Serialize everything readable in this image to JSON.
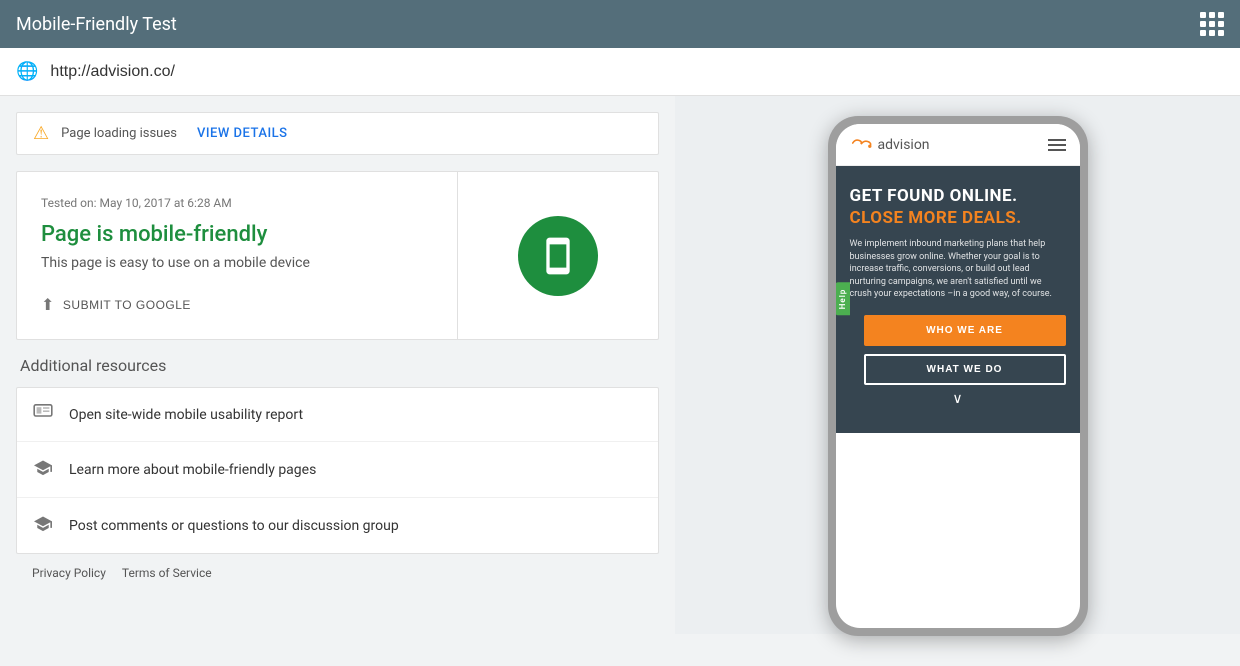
{
  "app": {
    "title": "Mobile-Friendly Test",
    "grid_icon_label": "apps"
  },
  "urlbar": {
    "url": "http://advision.co/"
  },
  "warning": {
    "text": "Page loading issues",
    "link": "VIEW DETAILS"
  },
  "result": {
    "tested_on": "Tested on: May 10, 2017 at 6:28 AM",
    "title": "Page is mobile-friendly",
    "description": "This page is easy to use on a mobile device",
    "submit_label": "SUBMIT TO GOOGLE"
  },
  "additional": {
    "title": "Additional resources",
    "items": [
      {
        "icon": "☰",
        "text": "Open site-wide mobile usability report"
      },
      {
        "icon": "🎓",
        "text": "Learn more about mobile-friendly pages"
      },
      {
        "icon": "🎓",
        "text": "Post comments or questions to our discussion group"
      }
    ]
  },
  "footer": {
    "privacy": "Privacy Policy",
    "terms": "Terms of Service"
  },
  "preview": {
    "logo_text": "advision",
    "hero_title_white": "GET FOUND ONLINE.",
    "hero_title_orange": "CLOSE MORE DEALS.",
    "hero_desc": "We implement inbound marketing plans that help businesses grow online. Whether your goal is to increase traffic, conversions, or build out lead nurturing campaigns, we aren't satisfied until we crush your expectations\n–in a good way, of course.",
    "help_tab": "Help",
    "btn_who": "WHO WE ARE",
    "btn_what": "WHAT WE DO"
  }
}
